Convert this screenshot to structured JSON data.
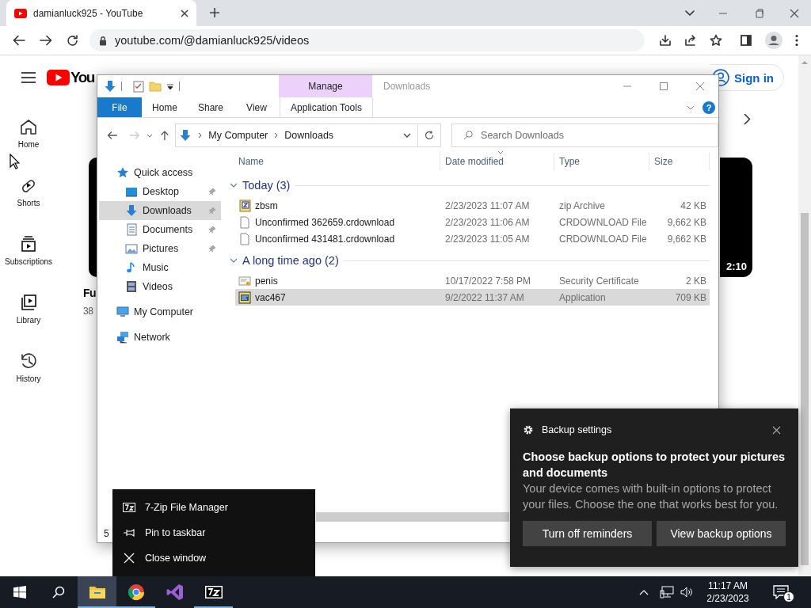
{
  "browser": {
    "tab": {
      "title": "damianluck925 - YouTube"
    },
    "address": "youtube.com/@damianluck925/videos"
  },
  "youtube": {
    "logo_text": "You",
    "sign_in": "Sign in",
    "guide": [
      {
        "kind": "home",
        "label": "Home"
      },
      {
        "kind": "shorts",
        "label": "Shorts"
      },
      {
        "kind": "subscriptions",
        "label": "Subscriptions"
      },
      {
        "kind": "library",
        "label": "Library"
      },
      {
        "kind": "history",
        "label": "History"
      }
    ],
    "left_video": {
      "title": "Fu",
      "meta": "38"
    },
    "right_video": {
      "duration": "2:10"
    }
  },
  "explorer": {
    "title": "Downloads",
    "context_group": "Manage",
    "ribbon_tabs": [
      {
        "kind": "file",
        "label": "File"
      },
      {
        "kind": "normal",
        "label": "Home"
      },
      {
        "kind": "normal",
        "label": "Share"
      },
      {
        "kind": "normal",
        "label": "View"
      },
      {
        "kind": "contextual",
        "label": "Application Tools"
      }
    ],
    "help": "?",
    "breadcrumb": [
      "My Computer",
      "Downloads"
    ],
    "search": {
      "placeholder": "Search Downloads"
    },
    "nav": [
      {
        "kind": "star",
        "label": "Quick access",
        "selected": false,
        "children": [
          {
            "kind": "desktop",
            "label": "Desktop",
            "pinned": true,
            "selected": false
          },
          {
            "kind": "downloads",
            "label": "Downloads",
            "pinned": true,
            "selected": true
          },
          {
            "kind": "documents",
            "label": "Documents",
            "pinned": true,
            "selected": false
          },
          {
            "kind": "pictures",
            "label": "Pictures",
            "pinned": true,
            "selected": false
          },
          {
            "kind": "music",
            "label": "Music",
            "pinned": false,
            "selected": false
          },
          {
            "kind": "videos",
            "label": "Videos",
            "pinned": false,
            "selected": false
          }
        ]
      },
      {
        "kind": "computer",
        "label": "My Computer",
        "selected": false
      },
      {
        "kind": "network",
        "label": "Network",
        "selected": false
      }
    ],
    "columns": [
      {
        "label": "Name",
        "sorted": false
      },
      {
        "label": "Date modified",
        "sorted": true
      },
      {
        "label": "Type",
        "sorted": false
      },
      {
        "label": "Size",
        "sorted": false
      }
    ],
    "groups": [
      {
        "label": "Today (3)",
        "expanded": true,
        "files": [
          {
            "kind": "zip",
            "name": "zbsm",
            "date": "2/23/2023 11:07 AM",
            "type": "zip Archive",
            "size": "42 KB",
            "selected": false
          },
          {
            "kind": "file",
            "name": "Unconfirmed 362659.crdownload",
            "date": "2/23/2023 11:06 AM",
            "type": "CRDOWNLOAD File",
            "size": "9,662 KB",
            "selected": false
          },
          {
            "kind": "file",
            "name": "Unconfirmed 431481.crdownload",
            "date": "2/23/2023 11:05 AM",
            "type": "CRDOWNLOAD File",
            "size": "9,662 KB",
            "selected": false
          }
        ]
      },
      {
        "label": "A long time ago (2)",
        "expanded": true,
        "files": [
          {
            "kind": "certificate",
            "name": "penis",
            "date": "10/17/2022 7:58 PM",
            "type": "Security Certificate",
            "size": "2 KB",
            "selected": false
          },
          {
            "kind": "application",
            "name": "vac467",
            "date": "9/2/2022 11:37 AM",
            "type": "Application",
            "size": "709 KB",
            "selected": true
          }
        ]
      }
    ],
    "status": "5"
  },
  "jump_list": {
    "items": [
      {
        "kind": "sevenzip",
        "label": "7-Zip File Manager"
      },
      {
        "kind": "pin",
        "label": "Pin to taskbar"
      },
      {
        "kind": "close",
        "label": "Close window"
      }
    ]
  },
  "toast": {
    "app": "Backup settings",
    "title": "Choose backup options to protect your pictures and documents",
    "body": "Your device comes with built-in options to protect your files. Choose the one that works best for you.",
    "buttons": [
      "Turn off reminders",
      "View backup options"
    ]
  },
  "taskbar": {
    "apps": [
      {
        "kind": "explorer",
        "selected": true,
        "running": true
      },
      {
        "kind": "chrome",
        "selected": false,
        "running": true
      },
      {
        "kind": "studio",
        "selected": false,
        "running": false
      },
      {
        "kind": "sevenzip",
        "selected": false,
        "running": true
      }
    ],
    "time": "11:17 AM",
    "date": "2/23/2023",
    "notifications": "1"
  }
}
